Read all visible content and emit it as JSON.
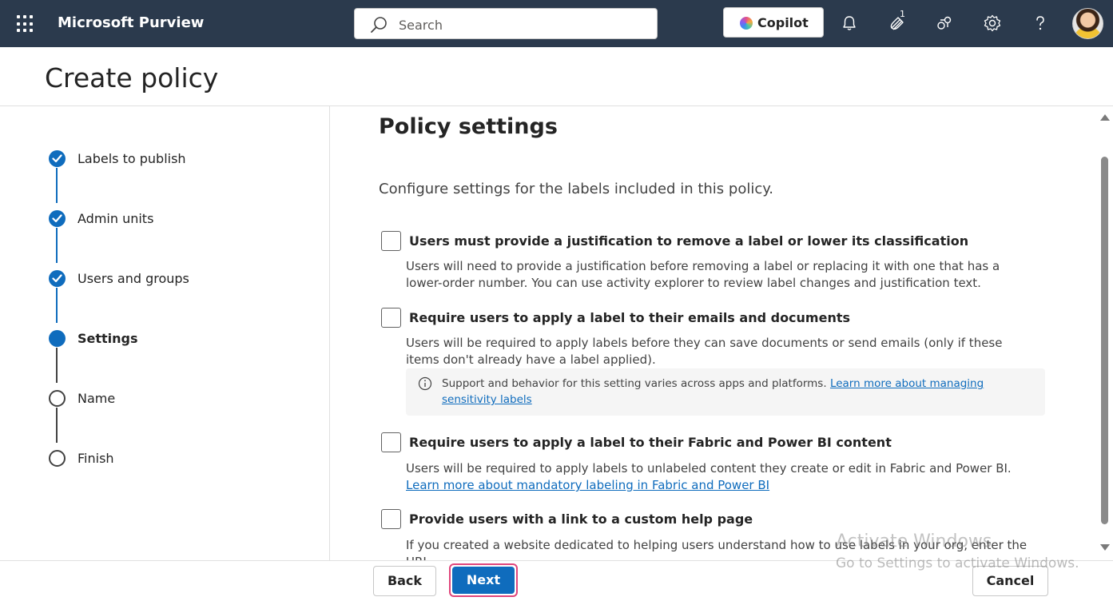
{
  "topbar": {
    "app_name": "Microsoft Purview",
    "search_placeholder": "Search",
    "copilot_label": "Copilot",
    "notification_count": "1"
  },
  "header": {
    "title": "Create policy"
  },
  "stepper": {
    "steps": [
      {
        "label": "Labels to publish",
        "state": "done"
      },
      {
        "label": "Admin units",
        "state": "done"
      },
      {
        "label": "Users and groups",
        "state": "done"
      },
      {
        "label": "Settings",
        "state": "current"
      },
      {
        "label": "Name",
        "state": "todo"
      },
      {
        "label": "Finish",
        "state": "todo"
      }
    ]
  },
  "content": {
    "title": "Policy settings",
    "description": "Configure settings for the labels included in this policy.",
    "options": [
      {
        "title": "Users must provide a justification to remove a label or lower its classification",
        "description": "Users will need to provide a justification before removing a label or replacing it with one that has a lower-order number. You can use activity explorer to review label changes and justification text.",
        "checked": false
      },
      {
        "title": "Require users to apply a label to their emails and documents",
        "description": "Users will be required to apply labels before they can save documents or send emails (only if these items don't already have a label applied).",
        "checked": false,
        "info_text": "Support and behavior for this setting varies across apps and platforms.",
        "info_link": "Learn more about managing sensitivity labels"
      },
      {
        "title": "Require users to apply a label to their Fabric and Power BI content",
        "description": "Users will be required to apply labels to unlabeled content they create or edit in Fabric and Power BI.",
        "link": "Learn more about mandatory labeling in Fabric and Power BI",
        "checked": false
      },
      {
        "title": "Provide users with a link to a custom help page",
        "description": "If you created a website dedicated to helping users understand how to use labels in your org, enter the URL",
        "checked": false
      }
    ]
  },
  "footer": {
    "back_label": "Back",
    "next_label": "Next",
    "cancel_label": "Cancel"
  },
  "watermark": {
    "line1": "Activate Windows",
    "line2": "Go to Settings to activate Windows."
  },
  "colors": {
    "topbar": "#2b3a4d",
    "accent": "#0f6cbd",
    "highlight": "#e0457b"
  }
}
